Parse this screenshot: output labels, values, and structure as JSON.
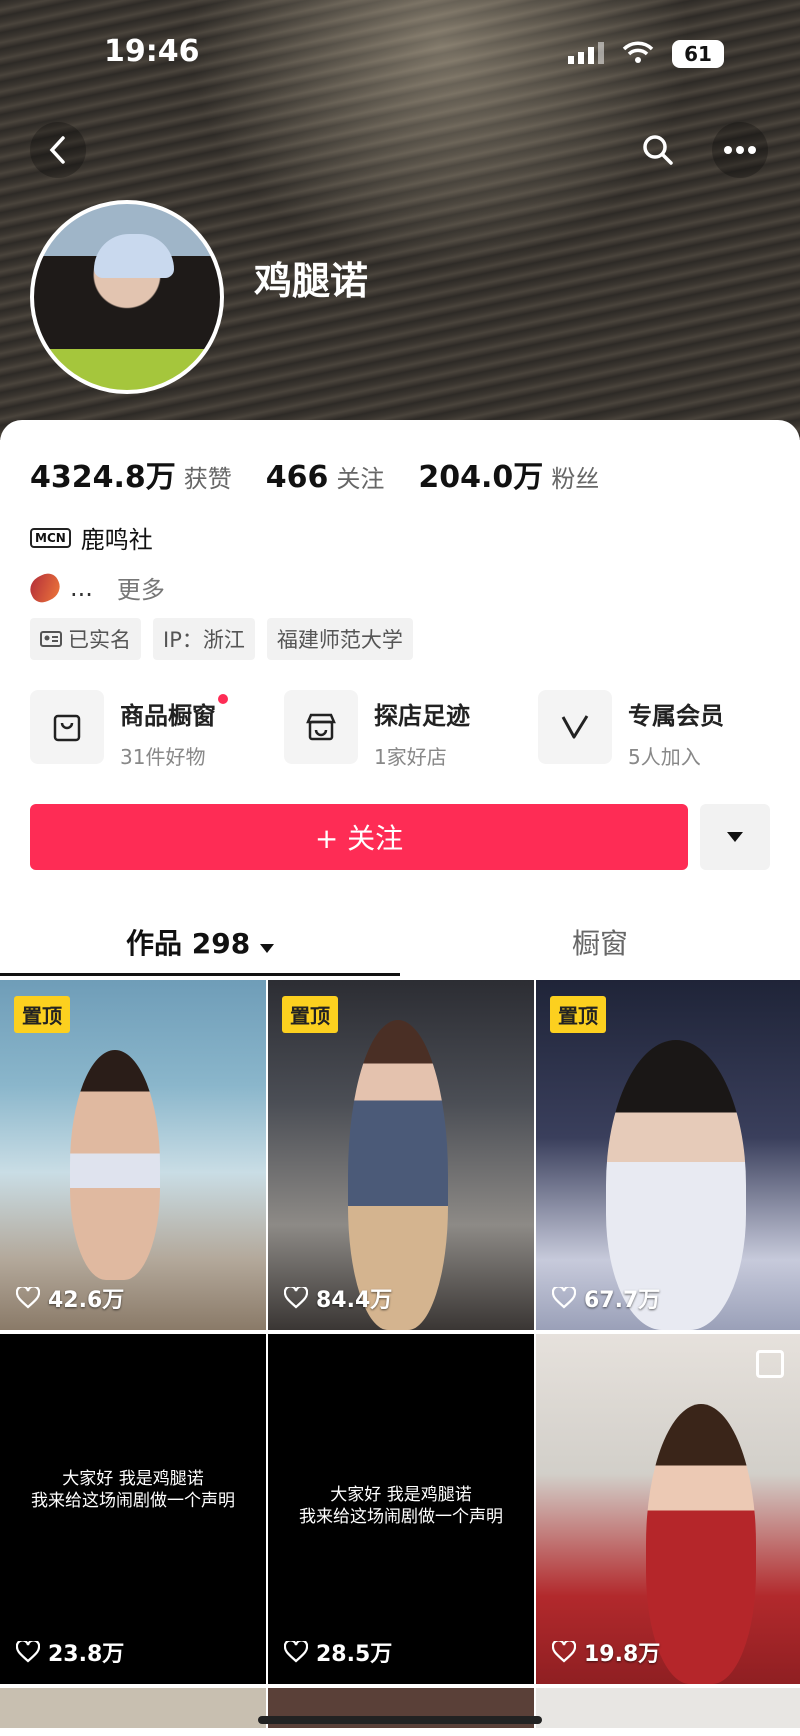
{
  "status_bar": {
    "time": "19:46",
    "battery": "61"
  },
  "profile": {
    "name": "鸡腿诺",
    "stats": [
      {
        "value": "4324.8万",
        "label": "获赞"
      },
      {
        "value": "466",
        "label": "关注"
      },
      {
        "value": "204.0万",
        "label": "粉丝"
      }
    ],
    "mcn_badge": "MCN",
    "mcn_name": "鹿鸣社",
    "bio_text": "...",
    "bio_more": "更多",
    "tags": [
      "已实名",
      "IP：浙江",
      "福建师范大学"
    ]
  },
  "features": [
    {
      "title": "商品橱窗",
      "subtitle": "31件好物",
      "icon": "bag-icon"
    },
    {
      "title": "探店足迹",
      "subtitle": "1家好店",
      "icon": "shop-icon"
    },
    {
      "title": "专属会员",
      "subtitle": "5人加入",
      "icon": "v-icon"
    }
  ],
  "follow_label": "+ 关注",
  "tabs": {
    "works": "作品 298",
    "window": "橱窗"
  },
  "grid": [
    {
      "pinned": "置顶",
      "likes": "42.6万"
    },
    {
      "pinned": "置顶",
      "likes": "84.4万"
    },
    {
      "pinned": "置顶",
      "likes": "67.7万"
    },
    {
      "caption": "大家好 我是鸡腿诺\n我来给这场闹剧做一个声明",
      "likes": "23.8万"
    },
    {
      "caption": "大家好 我是鸡腿诺\n我来给这场闹剧做一个声明",
      "likes": "28.5万"
    },
    {
      "likes": "19.8万"
    }
  ]
}
